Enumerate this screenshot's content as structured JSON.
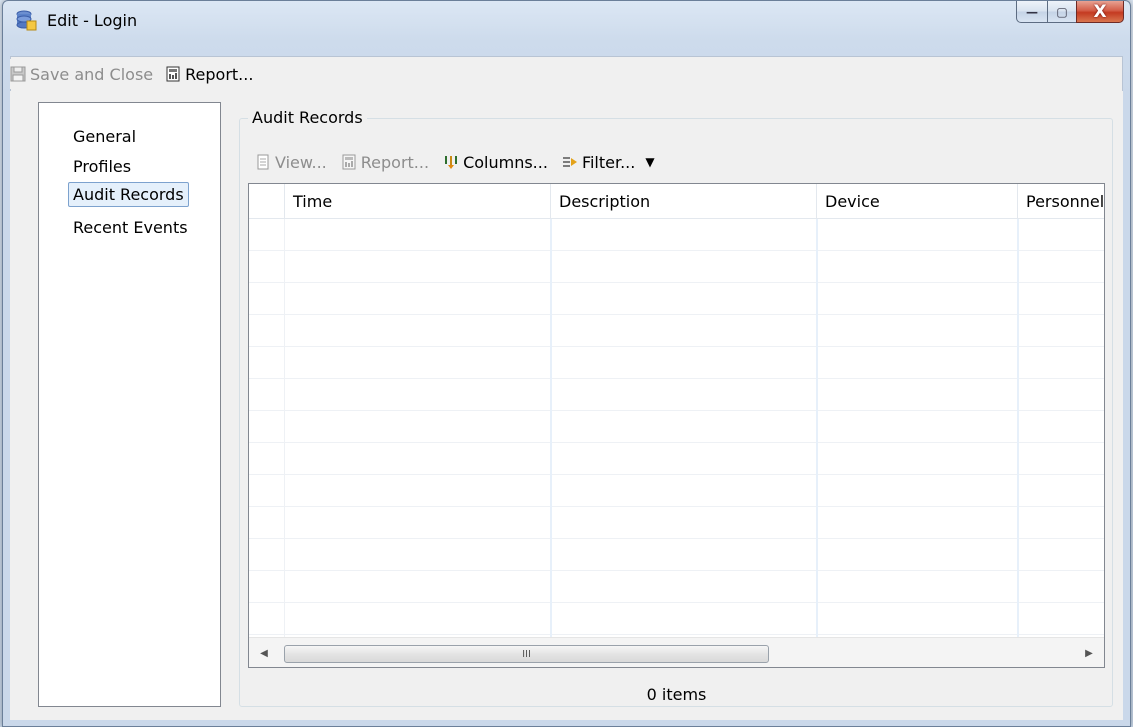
{
  "window": {
    "title": "Edit - Login",
    "controls": {
      "minimize": "—",
      "maximize": "▢",
      "close": "X"
    }
  },
  "toolbar": {
    "save_label": "Save and Close",
    "report_label": "Report..."
  },
  "nav": {
    "items": [
      {
        "label": "General"
      },
      {
        "label": "Profiles"
      },
      {
        "label": "Audit Records"
      },
      {
        "label": "Recent Events"
      }
    ],
    "selected": "Audit Records"
  },
  "audit": {
    "group_title": "Audit Records",
    "toolbar": {
      "view_label": "View...",
      "report_label": "Report...",
      "columns_label": "Columns...",
      "filter_label": "Filter...",
      "dropdown_glyph": "▼"
    },
    "columns": [
      "Time",
      "Description",
      "Device",
      "Personnel"
    ],
    "rows": [],
    "scroll": {
      "left": "◀",
      "right": "▶",
      "grip": "III"
    },
    "status": "0 items"
  },
  "icons": {
    "app": "database-icon",
    "save": "floppy-disk-icon",
    "report": "report-icon",
    "view": "view-icon",
    "columns": "columns-icon",
    "filter": "filter-icon"
  }
}
